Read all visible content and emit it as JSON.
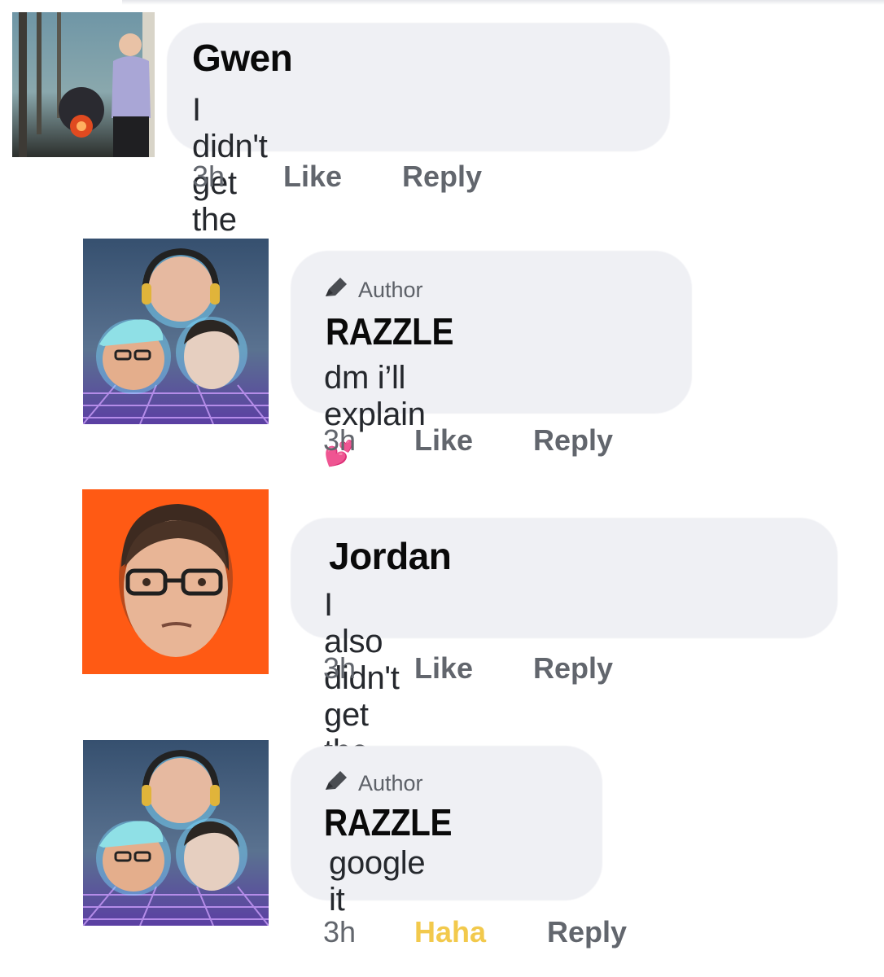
{
  "comments": [
    {
      "name": "Gwen",
      "text": "I didn't get the joke",
      "is_author": false,
      "author_label": "",
      "time": "3h",
      "reaction": "Like",
      "reply": "Reply"
    },
    {
      "name": "RAZZLE",
      "text": "dm i’ll explain",
      "emoji": "💕",
      "is_author": true,
      "author_label": "Author",
      "time": "3h",
      "reaction": "Like",
      "reply": "Reply"
    },
    {
      "name": "Jordan",
      "text": "I also didn't get the joke :(",
      "is_author": false,
      "author_label": "",
      "time": "3h",
      "reaction": "Like",
      "reply": "Reply"
    },
    {
      "name": "RAZZLE",
      "text": "google it",
      "is_author": true,
      "author_label": "Author",
      "time": "3h",
      "reaction": "Haha",
      "reply": "Reply"
    }
  ],
  "colors": {
    "bubble": "#eff0f4",
    "action_text": "#62666d",
    "haha": "#f2c94c",
    "jordan_avatar_bg": "#ff5a14"
  },
  "icons": {
    "author_badge": "pencil-icon"
  }
}
